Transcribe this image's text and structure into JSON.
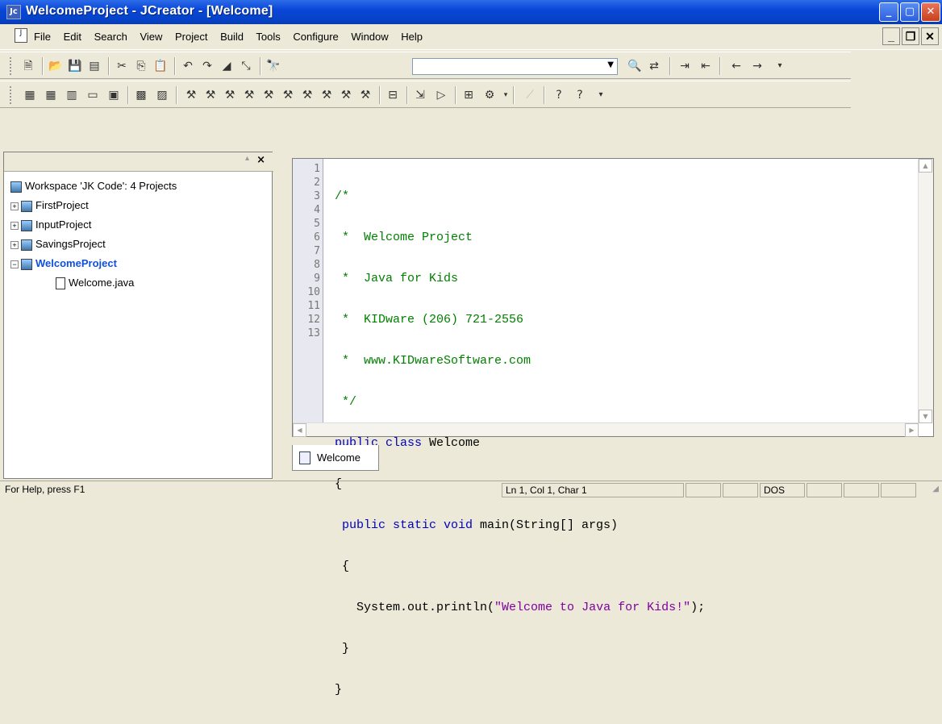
{
  "window": {
    "title": "WelcomeProject - JCreator - [Welcome]",
    "app_icon_label": "Jc"
  },
  "menu": {
    "items": [
      "File",
      "Edit",
      "Search",
      "View",
      "Project",
      "Build",
      "Tools",
      "Configure",
      "Window",
      "Help"
    ]
  },
  "toolbar1": {
    "icons": [
      "new-file-icon",
      "open-icon",
      "save-icon",
      "save-all-icon",
      "cut-icon",
      "copy-icon",
      "paste-icon",
      "undo-icon",
      "redo-icon",
      "bookmark-icon",
      "clear-bookmark-icon",
      "find-icon",
      "find-in-files-icon",
      "replace-icon",
      "indent-icon",
      "outdent-icon",
      "back-icon",
      "forward-icon"
    ],
    "find_value": ""
  },
  "workspace": {
    "title": "Workspace 'JK Code': 4 Projects",
    "projects": [
      {
        "name": "FirstProject",
        "expanded": false,
        "active": false
      },
      {
        "name": "InputProject",
        "expanded": false,
        "active": false
      },
      {
        "name": "SavingsProject",
        "expanded": false,
        "active": false
      },
      {
        "name": "WelcomeProject",
        "expanded": true,
        "active": true
      }
    ],
    "files": [
      "Welcome.java"
    ]
  },
  "editor": {
    "line_numbers": [
      "1",
      "2",
      "3",
      "4",
      "5",
      "6",
      "7",
      "8",
      "9",
      "10",
      "11",
      "12",
      "13"
    ],
    "lines": [
      {
        "text": "/*",
        "cls": "cm"
      },
      {
        "text": " *  Welcome Project",
        "cls": "cm"
      },
      {
        "text": " *  Java for Kids",
        "cls": "cm"
      },
      {
        "text": " *  KIDware (206) 721-2556",
        "cls": "cm"
      },
      {
        "text": " *  www.KIDwareSoftware.com",
        "cls": "cm"
      },
      {
        "text": " */",
        "cls": "cm"
      }
    ],
    "code_tail": {
      "l7_kw": "public class ",
      "l7_name": "Welcome",
      "l8": "{",
      "l9_kw": " public static void ",
      "l9_rest": "main(String[] args)",
      "l10": " {",
      "l11_pre": "   System.out.println(",
      "l11_str": "\"Welcome to Java for Kids!\"",
      "l11_post": ");",
      "l12": " }",
      "l13": "}"
    },
    "tab": "Welcome"
  },
  "status": {
    "help": "For Help, press F1",
    "position": "Ln 1, Col 1, Char 1",
    "mode": "DOS"
  }
}
